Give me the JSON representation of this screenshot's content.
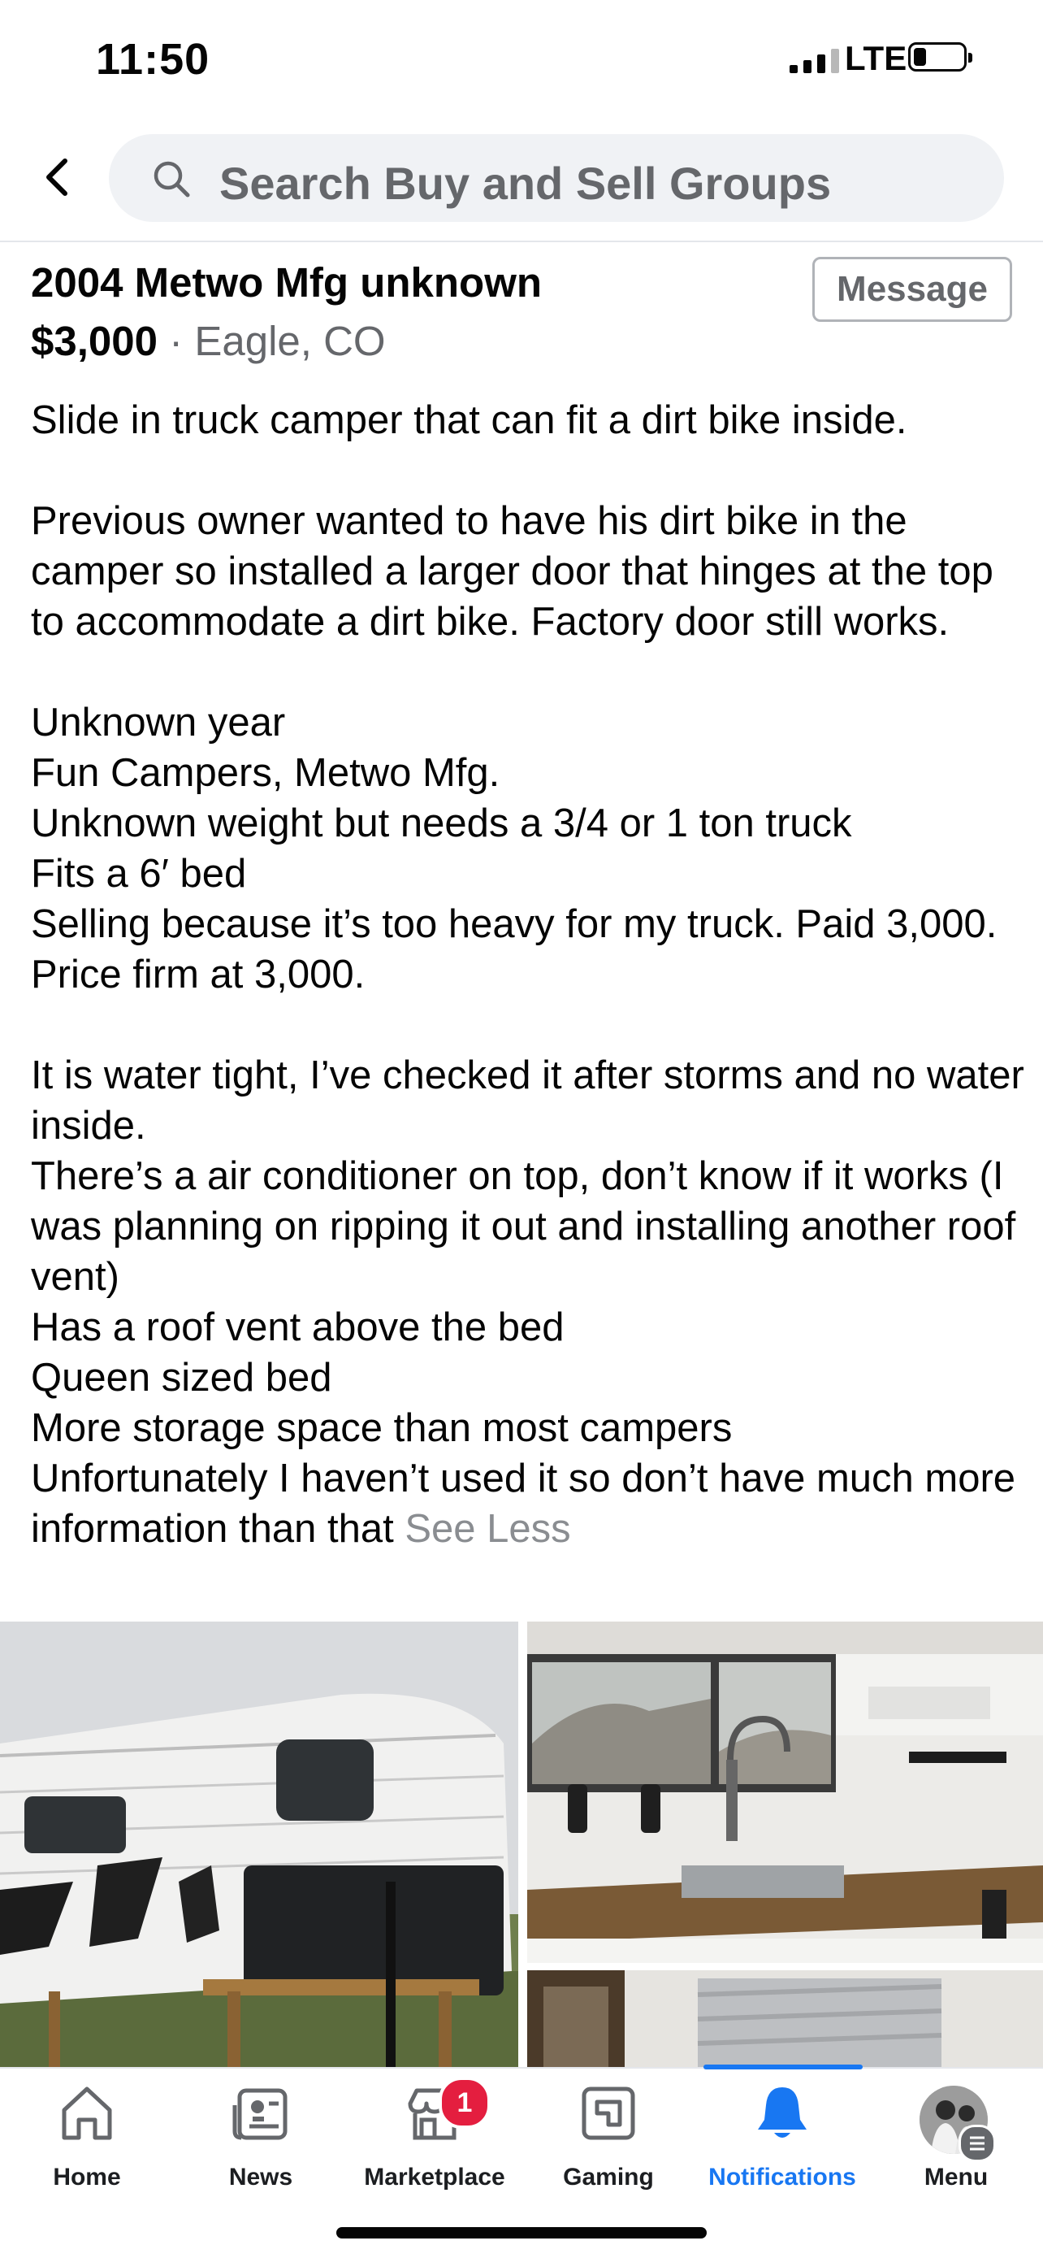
{
  "status_bar": {
    "time": "11:50",
    "network": "LTE",
    "battery_level": 0.25
  },
  "header": {
    "search_placeholder": "Search Buy and Sell Groups"
  },
  "listing": {
    "title": "2004 Metwo Mfg unknown",
    "price": "$3,000",
    "separator": " · ",
    "location": "Eagle, CO",
    "message_button": "Message",
    "description": "Slide in truck camper that can fit a dirt bike inside.\n\nPrevious owner wanted to have his dirt bike in the camper so installed a larger door that hinges at the top to accommodate a dirt bike. Factory door still works.\n\nUnknown year\nFun Campers, Metwo Mfg.\nUnknown weight but needs a 3/4 or 1 ton truck\nFits a 6′ bed\nSelling because it’s too heavy for my truck. Paid 3,000. Price firm at 3,000.\n\nIt is water tight, I’ve checked it after storms and no water inside.\nThere’s a air conditioner on top, don’t know if it works (I was planning on ripping it out and installing another roof vent)\nHas a roof vent above the bed\nQueen sized bed\nMore storage space than most campers\nUnfortunately I haven’t used it so don’t have much more information than that ",
    "see_less": "See Less"
  },
  "tabs": [
    {
      "label": "Home",
      "icon": "home-icon"
    },
    {
      "label": "News",
      "icon": "news-icon"
    },
    {
      "label": "Marketplace",
      "icon": "marketplace-icon",
      "badge": "1"
    },
    {
      "label": "Gaming",
      "icon": "gaming-icon"
    },
    {
      "label": "Notifications",
      "icon": "bell-icon",
      "active": true
    },
    {
      "label": "Menu",
      "icon": "avatar"
    }
  ],
  "colors": {
    "accent": "#1877f2",
    "badge": "#e41e3f",
    "secondary_text": "#65676b"
  }
}
